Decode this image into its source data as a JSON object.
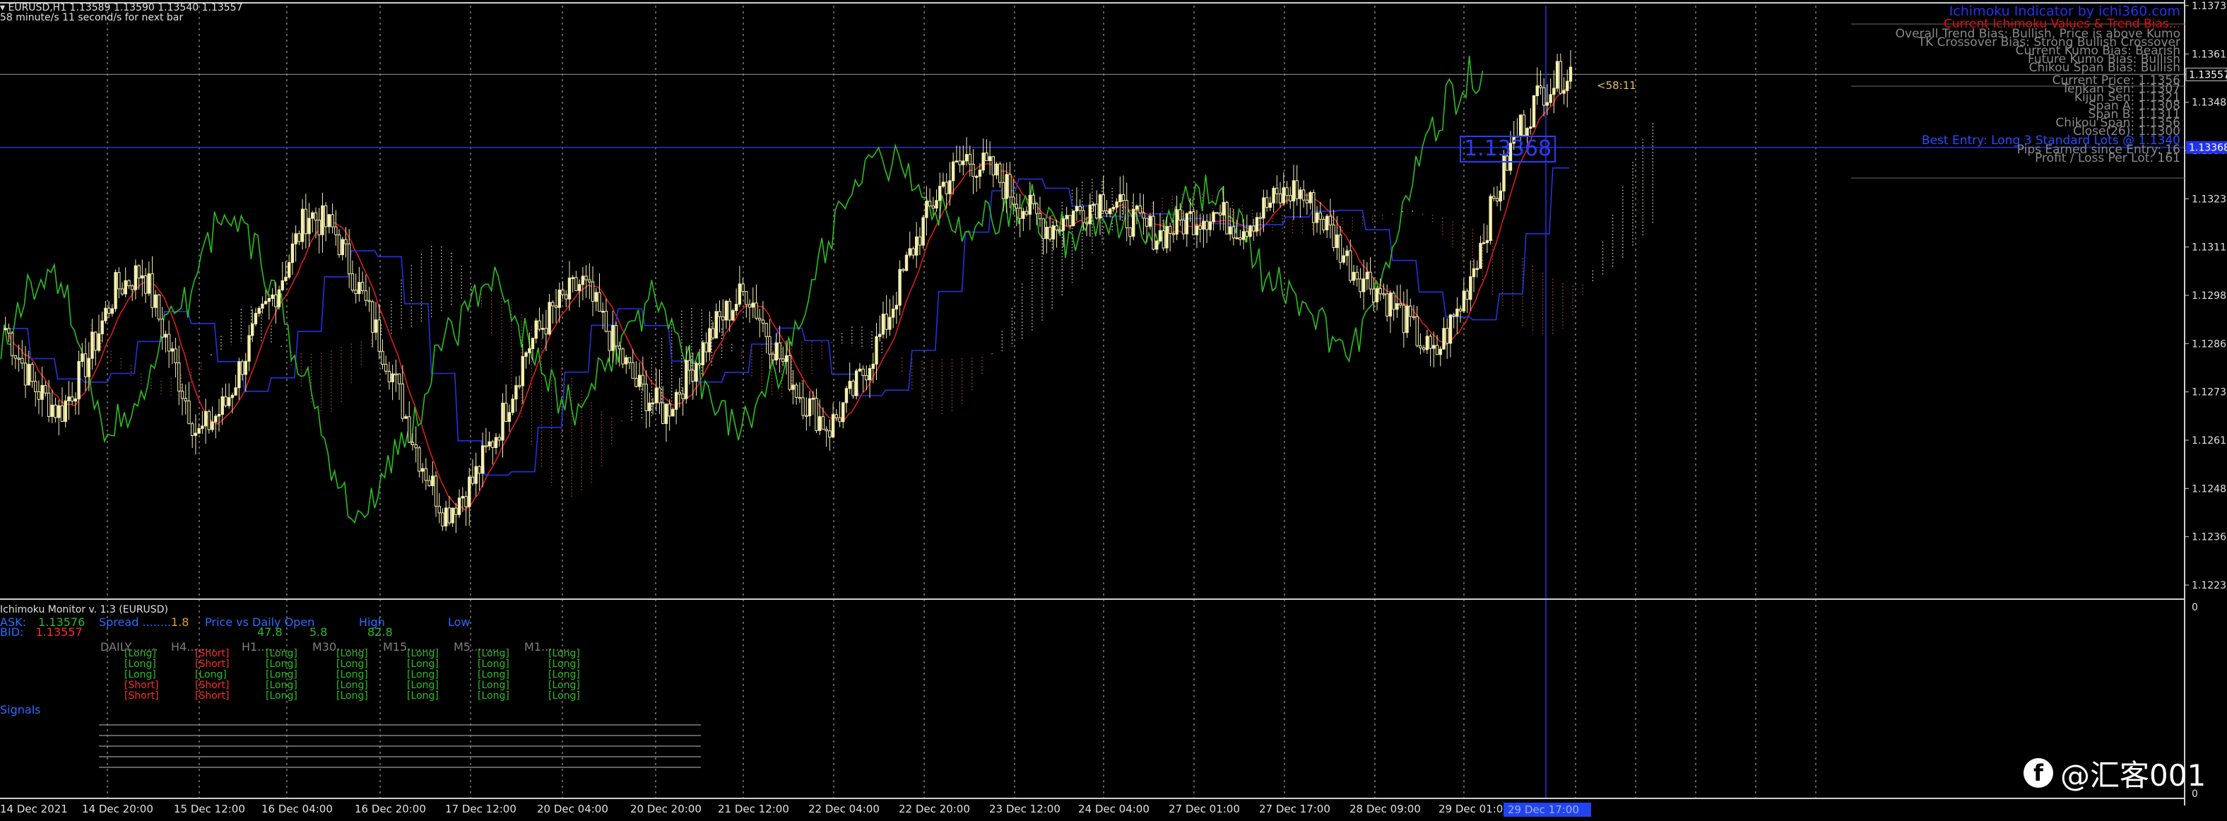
{
  "chart_header": {
    "symbol_line": "EURUSD,H1  1.13589 1.13590 1.13540 1.13557",
    "timer_line": "58 minute/s 11 second/s for next bar",
    "countdown_label": "<58:11"
  },
  "ichimoku_panel": {
    "title": "Ichimoku Indicator by ichi360.com",
    "subtitle": "Current Ichimoku Values & Trend Bias...",
    "bias_lines": [
      "Overall Trend Bias: Bullish, Price is above Kumo",
      "TK Crossover Bias: Strong Bullish Crossover",
      "Current Kumo Bias: Bearish",
      "Future Kumo Bias: Bullish",
      "Chikou Span Bias: Bullish"
    ],
    "value_lines": [
      "Current Price: 1.1356",
      "Tenkan Sen: 1.1307",
      "Kijun Sen: 1.1321",
      "Span A: 1.1308",
      "Span B: 1.1311",
      "Chikou Span: 1.1356",
      "Close(26): 1.1300"
    ],
    "best_entry": "Best Entry: Long 3 Standard Lots @ 1.1340",
    "pips_earned": "Pips Earned since Entry: 16",
    "profit_loss": "Profit / Loss Per Lot: 161",
    "entry_price_box": "1.13368"
  },
  "price_scale": {
    "main_labels": [
      "1.13735",
      "1.13610",
      "1.13557",
      "1.13485",
      "1.13360",
      "1.13235",
      "1.13110",
      "1.12985",
      "1.12860",
      "1.12735",
      "1.12610",
      "1.12485",
      "1.12360",
      "1.12235"
    ],
    "current_price_tag": "1.13557",
    "entry_price_tag": "1.13368",
    "sub_labels": [
      "0",
      "0"
    ]
  },
  "time_axis": {
    "labels": [
      "14 Dec 2021",
      "14 Dec 20:00",
      "15 Dec 12:00",
      "16 Dec 04:00",
      "16 Dec 20:00",
      "17 Dec 12:00",
      "20 Dec 04:00",
      "20 Dec 20:00",
      "21 Dec 12:00",
      "22 Dec 04:00",
      "22 Dec 20:00",
      "23 Dec 12:00",
      "24 Dec 04:00",
      "27 Dec 01:00",
      "27 Dec 17:00",
      "28 Dec 09:00",
      "29 Dec 01:00"
    ],
    "highlight_label": "29 Dec 17:00"
  },
  "monitor": {
    "title": "Ichimoku Monitor v. 1.3 (EURUSD)",
    "ask_label": "ASK:",
    "ask_value": "1.13576",
    "bid_label": "BID:",
    "bid_value": "1.13557",
    "spread_label": "Spread ........",
    "spread_value": "1.8",
    "price_vs_open_label": "Price vs Daily Open",
    "price_vs_open_value": "47.8",
    "high_label": "High",
    "high_value": "5.8",
    "low_label": "Low",
    "low_value": "82.8",
    "timeframes": [
      "DAILY........",
      "H4........",
      "H1........",
      "M30........",
      "M15........",
      "M5........",
      "M1........"
    ],
    "signals_label": "Signals",
    "columns": [
      [
        "[Long]",
        "[Long]",
        "[Long]",
        "[Short]",
        "[Short]"
      ],
      [
        "[Short]",
        "[Short]",
        "[Long]",
        "[Short]",
        "[Short]"
      ],
      [
        "[Long]",
        "[Long]",
        "[Long]",
        "[Long]",
        "[Long]"
      ],
      [
        "[Long]",
        "[Long]",
        "[Long]",
        "[Long]",
        "[Long]"
      ],
      [
        "[Long]",
        "[Long]",
        "[Long]",
        "[Long]",
        "[Long]"
      ],
      [
        "[Long]",
        "[Long]",
        "[Long]",
        "[Long]",
        "[Long]"
      ],
      [
        "[Long]",
        "[Long]",
        "[Long]",
        "[Long]",
        "[Long]"
      ]
    ]
  },
  "watermark": {
    "text": "@汇客001"
  },
  "colors": {
    "background": "#000000",
    "candle": "#f5f0b0",
    "chikou": "#2bbf1f",
    "tenkan": "#d81d1d",
    "kijun": "#2233dd",
    "kumo_bull": "#d8d8c8",
    "kumo_bear": "#b04a30",
    "grid": "#7a7a7a",
    "ask": "#2db82d",
    "bid": "#ff2a2a",
    "long": "#2bbf1f",
    "short": "#ff2a2a",
    "label_blue": "#2a6cff",
    "panel_title": "#2233ee",
    "panel_subtitle": "#dd1111",
    "panel_text": "#8a8a8a",
    "countdown": "#e0c060"
  }
}
